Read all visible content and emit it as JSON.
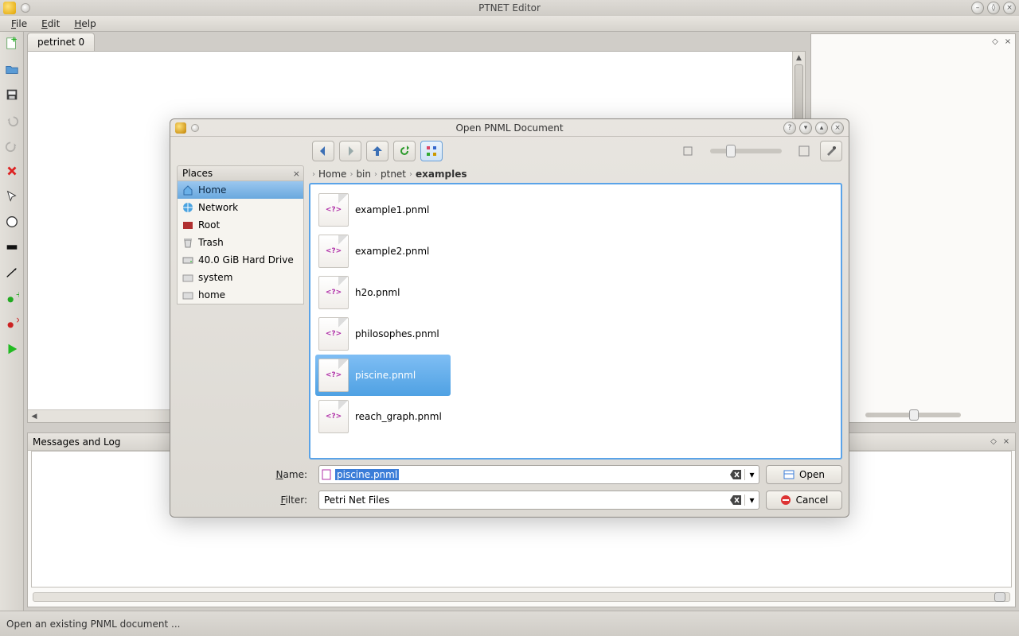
{
  "app": {
    "title": "PTNET Editor"
  },
  "menu": {
    "file": "File",
    "edit": "Edit",
    "help": "Help"
  },
  "tab": {
    "label": "petrinet 0"
  },
  "messages": {
    "title": "Messages and Log"
  },
  "status": {
    "text": "Open an existing PNML document ..."
  },
  "dialog": {
    "title": "Open PNML Document",
    "places_header": "Places",
    "places": [
      {
        "icon": "home",
        "label": "Home",
        "selected": true
      },
      {
        "icon": "network",
        "label": "Network"
      },
      {
        "icon": "root",
        "label": "Root"
      },
      {
        "icon": "trash",
        "label": "Trash"
      },
      {
        "icon": "drive",
        "label": "40.0 GiB Hard Drive"
      },
      {
        "icon": "folder",
        "label": "system"
      },
      {
        "icon": "folder",
        "label": "home"
      }
    ],
    "breadcrumb": [
      "Home",
      "bin",
      "ptnet",
      "examples"
    ],
    "files": [
      {
        "name": "example1.pnml"
      },
      {
        "name": "example2.pnml"
      },
      {
        "name": "h2o.pnml"
      },
      {
        "name": "philosophes.pnml"
      },
      {
        "name": "piscine.pnml",
        "selected": true
      },
      {
        "name": "reach_graph.pnml"
      }
    ],
    "name_label": "Name:",
    "name_value": "piscine.pnml",
    "filter_label": "Filter:",
    "filter_value": "Petri Net Files",
    "open_btn": "Open",
    "cancel_btn": "Cancel"
  }
}
